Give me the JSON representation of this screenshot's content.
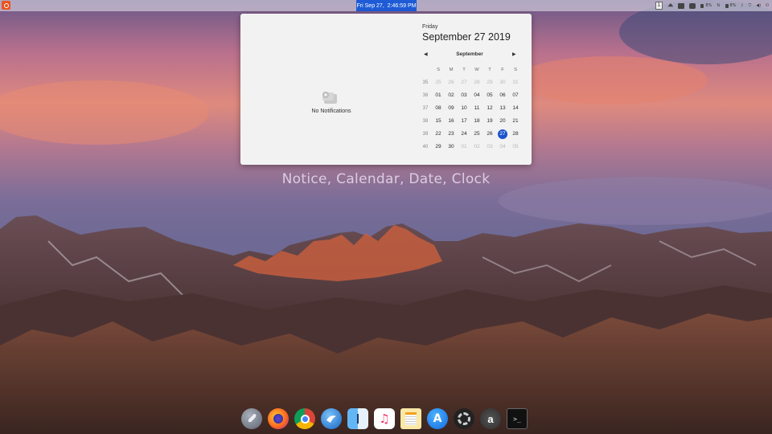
{
  "topbar": {
    "clock": "Fri Sep 27,  2:46:59 PM",
    "workspace": "1",
    "tray": [
      {
        "icon": "eject-icon"
      },
      {
        "icon": "drive-icon"
      },
      {
        "icon": "camera-icon"
      },
      {
        "icon": "cpu-indicator-icon",
        "value": "8%"
      },
      {
        "icon": "arrow-updown-icon"
      },
      {
        "icon": "memory-indicator-icon",
        "value": "8%"
      },
      {
        "icon": "bluetooth-icon"
      },
      {
        "icon": "network-icon"
      },
      {
        "icon": "volume-icon"
      },
      {
        "icon": "power-icon"
      }
    ]
  },
  "notifications": {
    "empty_text": "No Notifications",
    "icon": "notifications-empty-icon"
  },
  "calendar": {
    "day_name": "Friday",
    "full_date": "September 27 2019",
    "month": "September",
    "prev_icon": "chevron-left-icon",
    "next_icon": "chevron-right-icon",
    "weekday_headers": [
      "S",
      "M",
      "T",
      "W",
      "T",
      "F",
      "S"
    ],
    "weeks": [
      {
        "num": "35",
        "days": [
          [
            "25",
            "dim"
          ],
          [
            "26",
            "dim"
          ],
          [
            "27",
            "dim"
          ],
          [
            "28",
            "dim"
          ],
          [
            "29",
            "dim"
          ],
          [
            "30",
            "dim"
          ],
          [
            "31",
            "dim"
          ]
        ]
      },
      {
        "num": "36",
        "days": [
          [
            "01",
            ""
          ],
          [
            "02",
            ""
          ],
          [
            "03",
            ""
          ],
          [
            "04",
            ""
          ],
          [
            "05",
            ""
          ],
          [
            "06",
            ""
          ],
          [
            "07",
            ""
          ]
        ]
      },
      {
        "num": "37",
        "days": [
          [
            "08",
            ""
          ],
          [
            "09",
            ""
          ],
          [
            "10",
            ""
          ],
          [
            "11",
            ""
          ],
          [
            "12",
            ""
          ],
          [
            "13",
            ""
          ],
          [
            "14",
            ""
          ]
        ]
      },
      {
        "num": "38",
        "days": [
          [
            "15",
            ""
          ],
          [
            "16",
            ""
          ],
          [
            "17",
            ""
          ],
          [
            "18",
            ""
          ],
          [
            "19",
            ""
          ],
          [
            "20",
            ""
          ],
          [
            "21",
            ""
          ]
        ]
      },
      {
        "num": "39",
        "days": [
          [
            "22",
            ""
          ],
          [
            "23",
            ""
          ],
          [
            "24",
            ""
          ],
          [
            "25",
            ""
          ],
          [
            "26",
            ""
          ],
          [
            "27",
            "today"
          ],
          [
            "28",
            ""
          ]
        ]
      },
      {
        "num": "40",
        "days": [
          [
            "29",
            ""
          ],
          [
            "30",
            ""
          ],
          [
            "01",
            "dim"
          ],
          [
            "02",
            "dim"
          ],
          [
            "03",
            "dim"
          ],
          [
            "04",
            "dim"
          ],
          [
            "05",
            "dim"
          ]
        ]
      }
    ],
    "accent_color": "#1b53cf"
  },
  "caption": "Notice, Calendar, Date, Clock",
  "dock": [
    {
      "name": "launchpad",
      "icon": "rocket-icon"
    },
    {
      "name": "firefox",
      "icon": "firefox-icon"
    },
    {
      "name": "chrome",
      "icon": "chrome-icon"
    },
    {
      "name": "thunderbird",
      "icon": "thunderbird-icon"
    },
    {
      "name": "finder",
      "icon": "finder-icon"
    },
    {
      "name": "music",
      "icon": "music-icon"
    },
    {
      "name": "notes",
      "icon": "notes-icon"
    },
    {
      "name": "app-store",
      "icon": "app-store-icon"
    },
    {
      "name": "settings",
      "icon": "settings-ring-icon"
    },
    {
      "name": "amazon",
      "icon": "amazon-icon"
    },
    {
      "name": "terminal",
      "icon": "terminal-icon"
    }
  ]
}
